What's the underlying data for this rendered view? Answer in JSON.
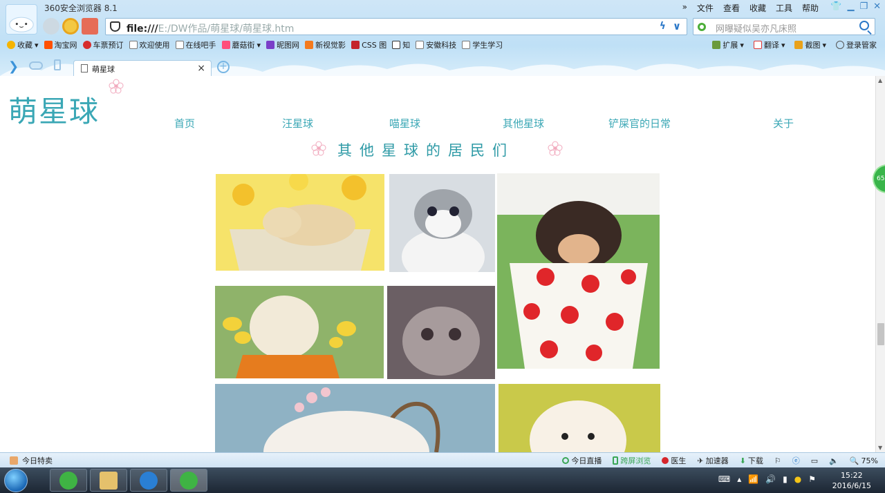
{
  "browser": {
    "app_title": "360安全浏览器 8.1",
    "menu": [
      "文件",
      "查看",
      "收藏",
      "工具",
      "帮助"
    ],
    "address": {
      "scheme": "file:///",
      "path": "E:/DW作品/萌星球/萌星球.htm"
    },
    "search_placeholder": "网曝疑似吴亦凡床照",
    "bookmarks": [
      {
        "label": "收藏",
        "icon": "star-icon",
        "color": "#f5b400"
      },
      {
        "label": "淘宝网",
        "icon": "taobao-icon",
        "color": "#ff5000"
      },
      {
        "label": "车票预订",
        "icon": "ticket-icon",
        "color": "#d62d2d"
      },
      {
        "label": "欢迎使用",
        "icon": "page-icon",
        "color": "#ffffff"
      },
      {
        "label": "在线吧手",
        "icon": "page-icon",
        "color": "#ffffff"
      },
      {
        "label": "蘑菇街",
        "icon": "mogujie-icon",
        "color": "#ff4f7b"
      },
      {
        "label": "昵图网",
        "icon": "nipic-icon",
        "color": "#7a3fc8"
      },
      {
        "label": "新视觉影",
        "icon": "video-icon",
        "color": "#f47a1d"
      },
      {
        "label": "CSS 图",
        "icon": "css-icon",
        "color": "#c4242b"
      },
      {
        "label": "知",
        "icon": "zhi-icon",
        "color": "#ffffff"
      },
      {
        "label": "安徽科技",
        "icon": "page-icon",
        "color": "#ffffff"
      },
      {
        "label": "学生学习",
        "icon": "page-icon",
        "color": "#ffffff"
      }
    ],
    "extensions": [
      {
        "label": "扩展",
        "icon": "extension-icon"
      },
      {
        "label": "翻译",
        "icon": "translate-icon"
      },
      {
        "label": "截图",
        "icon": "screenshot-icon"
      },
      {
        "label": "登录管家",
        "icon": "key-icon"
      }
    ],
    "tab_label": "萌星球",
    "tab_close": "×",
    "tab_new": "+"
  },
  "site": {
    "logo": "萌星球",
    "nav": [
      {
        "label": "首页"
      },
      {
        "label": "汪星球"
      },
      {
        "label": "喵星球"
      },
      {
        "label": "其他星球"
      },
      {
        "label": "铲屎官的日常"
      },
      {
        "label": "关于"
      }
    ],
    "section_title": "其他星球的居民们",
    "photos": [
      {
        "name": "photo-puppy-basket",
        "subject": "sleeping puppy in a flower basket",
        "bg": "#f6e36a",
        "fg": "#e9d3a8"
      },
      {
        "name": "photo-kitten-gray",
        "subject": "gray and white kitten looking up",
        "bg": "#d8dde2",
        "fg": "#8c9197"
      },
      {
        "name": "photo-puppy-cup",
        "subject": "chihuahua puppy in a polka-dot cup",
        "bg": "#7bb45c",
        "fg": "#3a2a24"
      },
      {
        "name": "photo-labrador-flowers",
        "subject": "labrador puppy holding yellow tulips",
        "bg": "#8fb36a",
        "fg": "#f2ead8"
      },
      {
        "name": "photo-scottish-fold",
        "subject": "scottish fold cat",
        "bg": "#6b5f64",
        "fg": "#a79b9c"
      },
      {
        "name": "photo-fluffy-basket",
        "subject": "fluffy white pet in a basket with blossoms",
        "bg": "#8fb2c4",
        "fg": "#f4f0ea"
      },
      {
        "name": "photo-pomeranian",
        "subject": "white pomeranian puppy",
        "bg": "#c9c94a",
        "fg": "#f8f1e6"
      }
    ]
  },
  "statusbar": {
    "left": "今日特卖",
    "items": [
      {
        "label": "今日直播",
        "icon": "live-icon",
        "color": "#3aa655"
      },
      {
        "label": "跨屏浏览",
        "icon": "phone-icon",
        "color": "#3aa655"
      },
      {
        "label": "医生",
        "icon": "doctor-icon",
        "color": "#d6252b"
      },
      {
        "label": "加速器",
        "icon": "rocket-icon",
        "color": "#555555"
      },
      {
        "label": "下载",
        "icon": "download-icon",
        "color": "#3aa655"
      }
    ],
    "zoom": "75%"
  },
  "taskbar": {
    "time": "15:22",
    "date": "2016/6/15"
  },
  "side_badge": "65"
}
